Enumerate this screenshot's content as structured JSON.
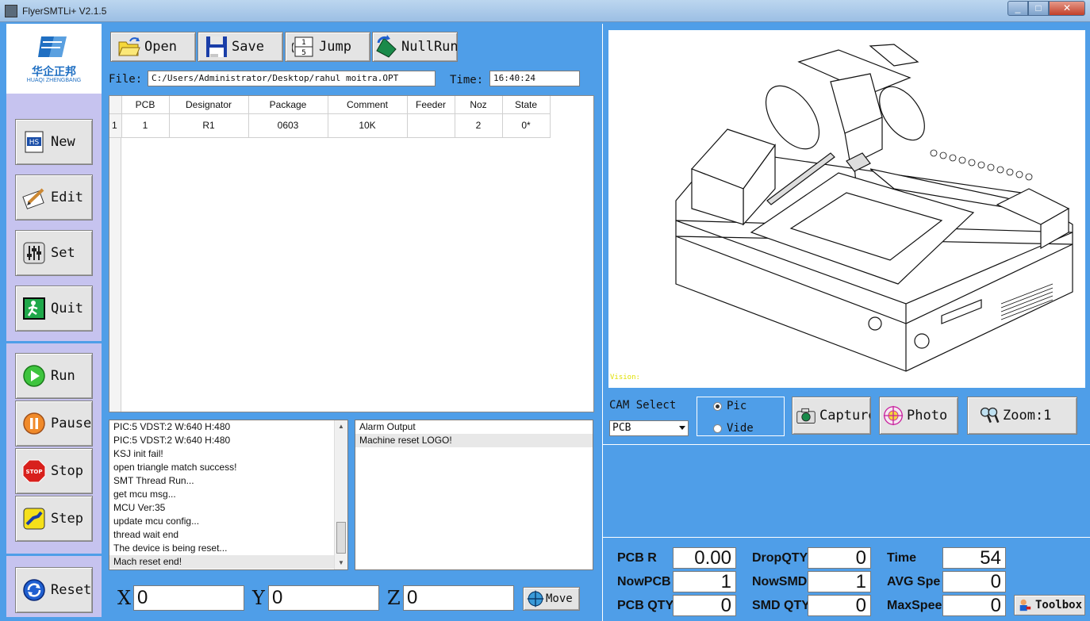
{
  "window": {
    "title": "FlyerSMTLi+ V2.1.5",
    "min": "_",
    "max": "□",
    "close": "✕"
  },
  "logo": {
    "cn": "华企正邦",
    "en": "HUAQI ZHENGBANG"
  },
  "sidebar": {
    "new": "New",
    "edit": "Edit",
    "set": "Set",
    "quit": "Quit",
    "run": "Run",
    "pause": "Pause",
    "stop": "Stop",
    "step": "Step",
    "reset": "Reset",
    "new_icon_text": "HS",
    "stop_icon_text": "STOP"
  },
  "toolbar": {
    "open": "Open",
    "save": "Save",
    "jump": "Jump",
    "nullrun": "NullRun"
  },
  "file": {
    "label": "File:",
    "value": "C:/Users/Administrator/Desktop/rahul moitra.OPT"
  },
  "time": {
    "label": "Time:",
    "value": "16:40:24"
  },
  "grid": {
    "headers": [
      "PCB",
      "Designator",
      "Package",
      "Comment",
      "Feeder",
      "Noz",
      "State"
    ],
    "rows": [
      {
        "num": "1",
        "pcb": "1",
        "designator": "R1",
        "package": "0603",
        "comment": "10K",
        "feeder": "",
        "noz": "2",
        "state": "0*"
      }
    ]
  },
  "log": [
    "PIC:5 VDST:2 W:640 H:480",
    "PIC:5 VDST:2 W:640 H:480",
    "KSJ init fail!",
    "open triangle match success!",
    "SMT Thread Run...",
    "get mcu msg...",
    "MCU Ver:35",
    "update mcu config...",
    "thread wait end",
    "The device is being reset...",
    "Mach reset end!"
  ],
  "alarm": {
    "header": "Alarm Output",
    "lines": [
      "Machine reset LOGO!"
    ]
  },
  "coords": {
    "x_label": "X",
    "x": "0",
    "y_label": "Y",
    "y": "0",
    "z_label": "Z",
    "z": "0",
    "move": "Move"
  },
  "vision": {
    "label": "Vision:"
  },
  "cam": {
    "label": "CAM Select",
    "selected": "PCB",
    "pic": "Pic",
    "video": "Vide",
    "capture": "Capture",
    "photo": "Photo",
    "zoom": "Zoom:1"
  },
  "stats": {
    "pcb_r_label": "PCB R",
    "pcb_r": "0.00",
    "dropqty_label": "DropQTY",
    "dropqty": "0",
    "time_label": "Time",
    "time": "54",
    "nowpcb_label": "NowPCB",
    "nowpcb": "1",
    "nowsmd_label": "NowSMD",
    "nowsmd": "1",
    "avgspe_label": "AVG Spe",
    "avgspe": "0",
    "pcbqty_label": "PCB QTY",
    "pcbqty": "0",
    "smdqty_label": "SMD QTY",
    "smdqty": "0",
    "maxspee_label": "MaxSpee",
    "maxspee": "0",
    "toolbox": "Toolbox"
  }
}
